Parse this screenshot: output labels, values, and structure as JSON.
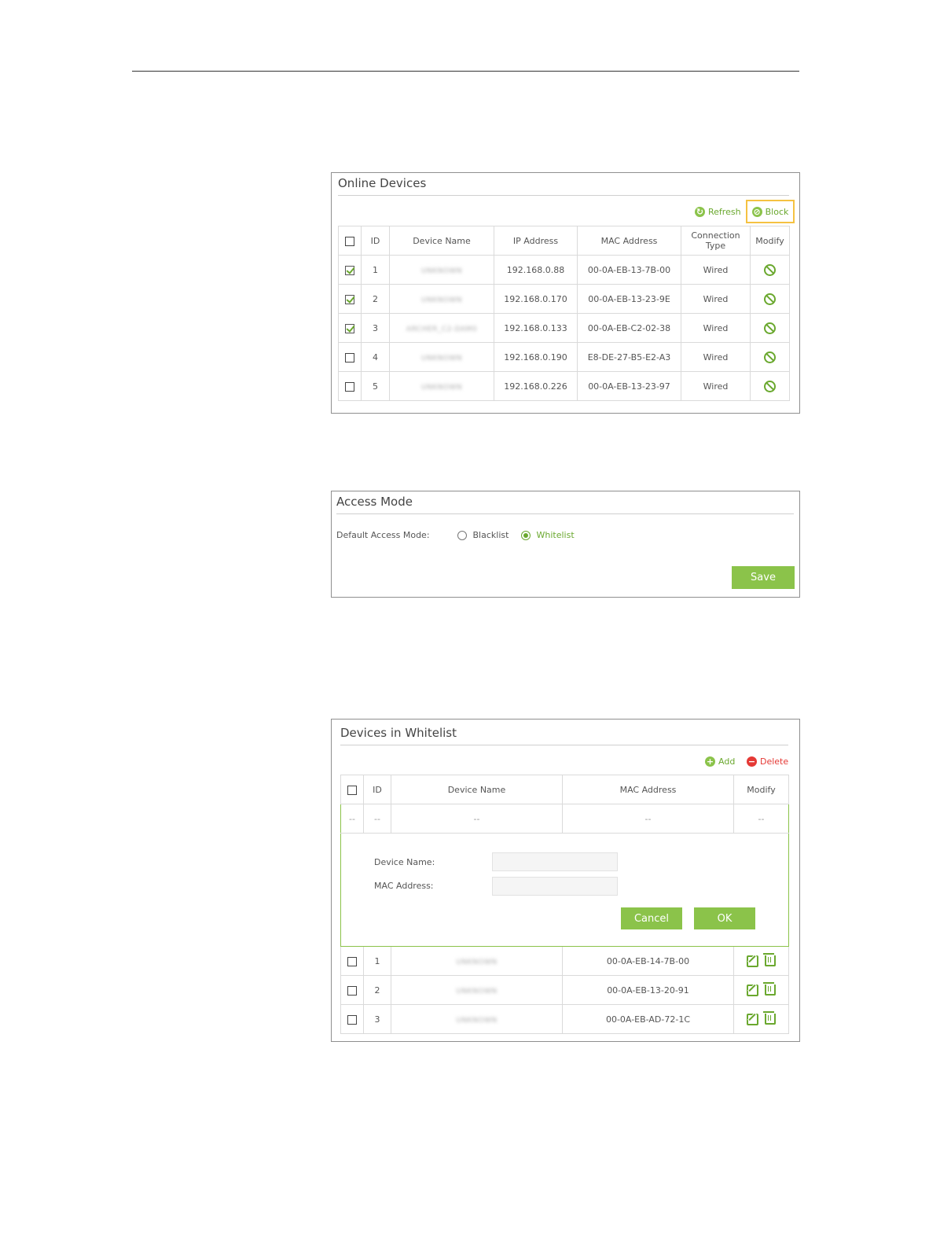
{
  "online_devices": {
    "title": "Online Devices",
    "refresh_label": "Refresh",
    "block_label": "Block",
    "columns": [
      "ID",
      "Device Name",
      "IP Address",
      "MAC Address",
      "Connection Type",
      "Modify"
    ],
    "rows": [
      {
        "checked": true,
        "id": "1",
        "name": "UNKNOWN",
        "ip": "192.168.0.88",
        "mac": "00-0A-EB-13-7B-00",
        "type": "Wired"
      },
      {
        "checked": true,
        "id": "2",
        "name": "UNKNOWN",
        "ip": "192.168.0.170",
        "mac": "00-0A-EB-13-23-9E",
        "type": "Wired"
      },
      {
        "checked": true,
        "id": "3",
        "name": "ARCHER_C2-DAM0",
        "ip": "192.168.0.133",
        "mac": "00-0A-EB-C2-02-38",
        "type": "Wired"
      },
      {
        "checked": false,
        "id": "4",
        "name": "UNKNOWN",
        "ip": "192.168.0.190",
        "mac": "E8-DE-27-B5-E2-A3",
        "type": "Wired"
      },
      {
        "checked": false,
        "id": "5",
        "name": "UNKNOWN",
        "ip": "192.168.0.226",
        "mac": "00-0A-EB-13-23-97",
        "type": "Wired"
      }
    ]
  },
  "access_mode": {
    "title": "Access Mode",
    "label": "Default Access Mode:",
    "options": [
      "Blacklist",
      "Whitelist"
    ],
    "selected": "Whitelist",
    "save_label": "Save"
  },
  "whitelist": {
    "title": "Devices in Whitelist",
    "add_label": "Add",
    "delete_label": "Delete",
    "columns": [
      "ID",
      "Device Name",
      "MAC Address",
      "Modify"
    ],
    "placeholder_row": [
      "--",
      "--",
      "--",
      "--",
      "--"
    ],
    "form": {
      "device_name_label": "Device Name:",
      "mac_label": "MAC Address:",
      "cancel_label": "Cancel",
      "ok_label": "OK"
    },
    "rows": [
      {
        "id": "1",
        "name": "UNKNOWN",
        "mac": "00-0A-EB-14-7B-00"
      },
      {
        "id": "2",
        "name": "UNKNOWN",
        "mac": "00-0A-EB-13-20-91"
      },
      {
        "id": "3",
        "name": "UNKNOWN",
        "mac": "00-0A-EB-AD-72-1C"
      }
    ]
  },
  "colors": {
    "accent": "#8bc34a",
    "delete": "#e53935",
    "highlight": "#f5c242"
  }
}
